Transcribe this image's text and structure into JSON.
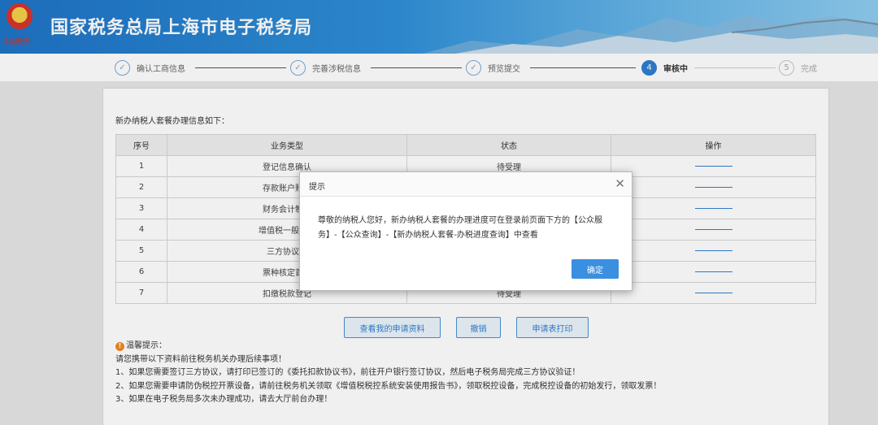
{
  "header": {
    "title": "国家税务总局上海市电子税务局",
    "emblem_text": "中国税务",
    "background": "#2f8fd8"
  },
  "steps": [
    {
      "label": "确认工商信息",
      "marker": "✓",
      "state": "done"
    },
    {
      "label": "完善涉税信息",
      "marker": "✓",
      "state": "done"
    },
    {
      "label": "预览提交",
      "marker": "✓",
      "state": "done"
    },
    {
      "label": "审核中",
      "marker": "4",
      "state": "active"
    },
    {
      "label": "完成",
      "marker": "5",
      "state": "future"
    }
  ],
  "main": {
    "intro": "新办纳税人套餐办理信息如下：",
    "table": {
      "headers": [
        "序号",
        "业务类型",
        "状态",
        "操作"
      ],
      "rows": [
        {
          "no": "1",
          "type": "登记信息确认",
          "status": "待受理"
        },
        {
          "no": "2",
          "type": "存款账户账号",
          "status": ""
        },
        {
          "no": "3",
          "type": "财务会计制度",
          "status": ""
        },
        {
          "no": "4",
          "type": "增值税一般纳税",
          "status": ""
        },
        {
          "no": "5",
          "type": "三方协议签",
          "status": ""
        },
        {
          "no": "6",
          "type": "票种核定首次",
          "status": ""
        },
        {
          "no": "7",
          "type": "扣缴税款登记",
          "status": "待受理"
        }
      ]
    },
    "buttons": {
      "view": "查看我的申请资料",
      "revoke": "撤销",
      "print": "申请表打印"
    },
    "tips": {
      "title": "温馨提示：",
      "lines": [
        "请您携带以下资料前往税务机关办理后续事项！",
        "1、如果您需要签订三方协议，请打印已签订的《委托扣款协议书》，前往开户银行签订协议，然后电子税务局完成三方协议验证！",
        "2、如果您需要申请防伪税控开票设备，请前往税务机关领取《增值税税控系统安装使用报告书》，领取税控设备，完成税控设备的初始发行，领取发票！",
        "3、如果在电子税务局多次未办理成功，请去大厅前台办理！"
      ]
    }
  },
  "dialog": {
    "title": "提示",
    "message_line1": "尊敬的纳税人您好，新办纳税人套餐的办理进度可在登录前页面下方的【公众服",
    "message_line2": "务】-【公众查询】-【新办纳税人套餐-办税进度查询】中查看",
    "ok_label": "确定",
    "close_glyph": "✕"
  },
  "colors": {
    "accent": "#2f7fd0",
    "warn": "#f08a24"
  }
}
